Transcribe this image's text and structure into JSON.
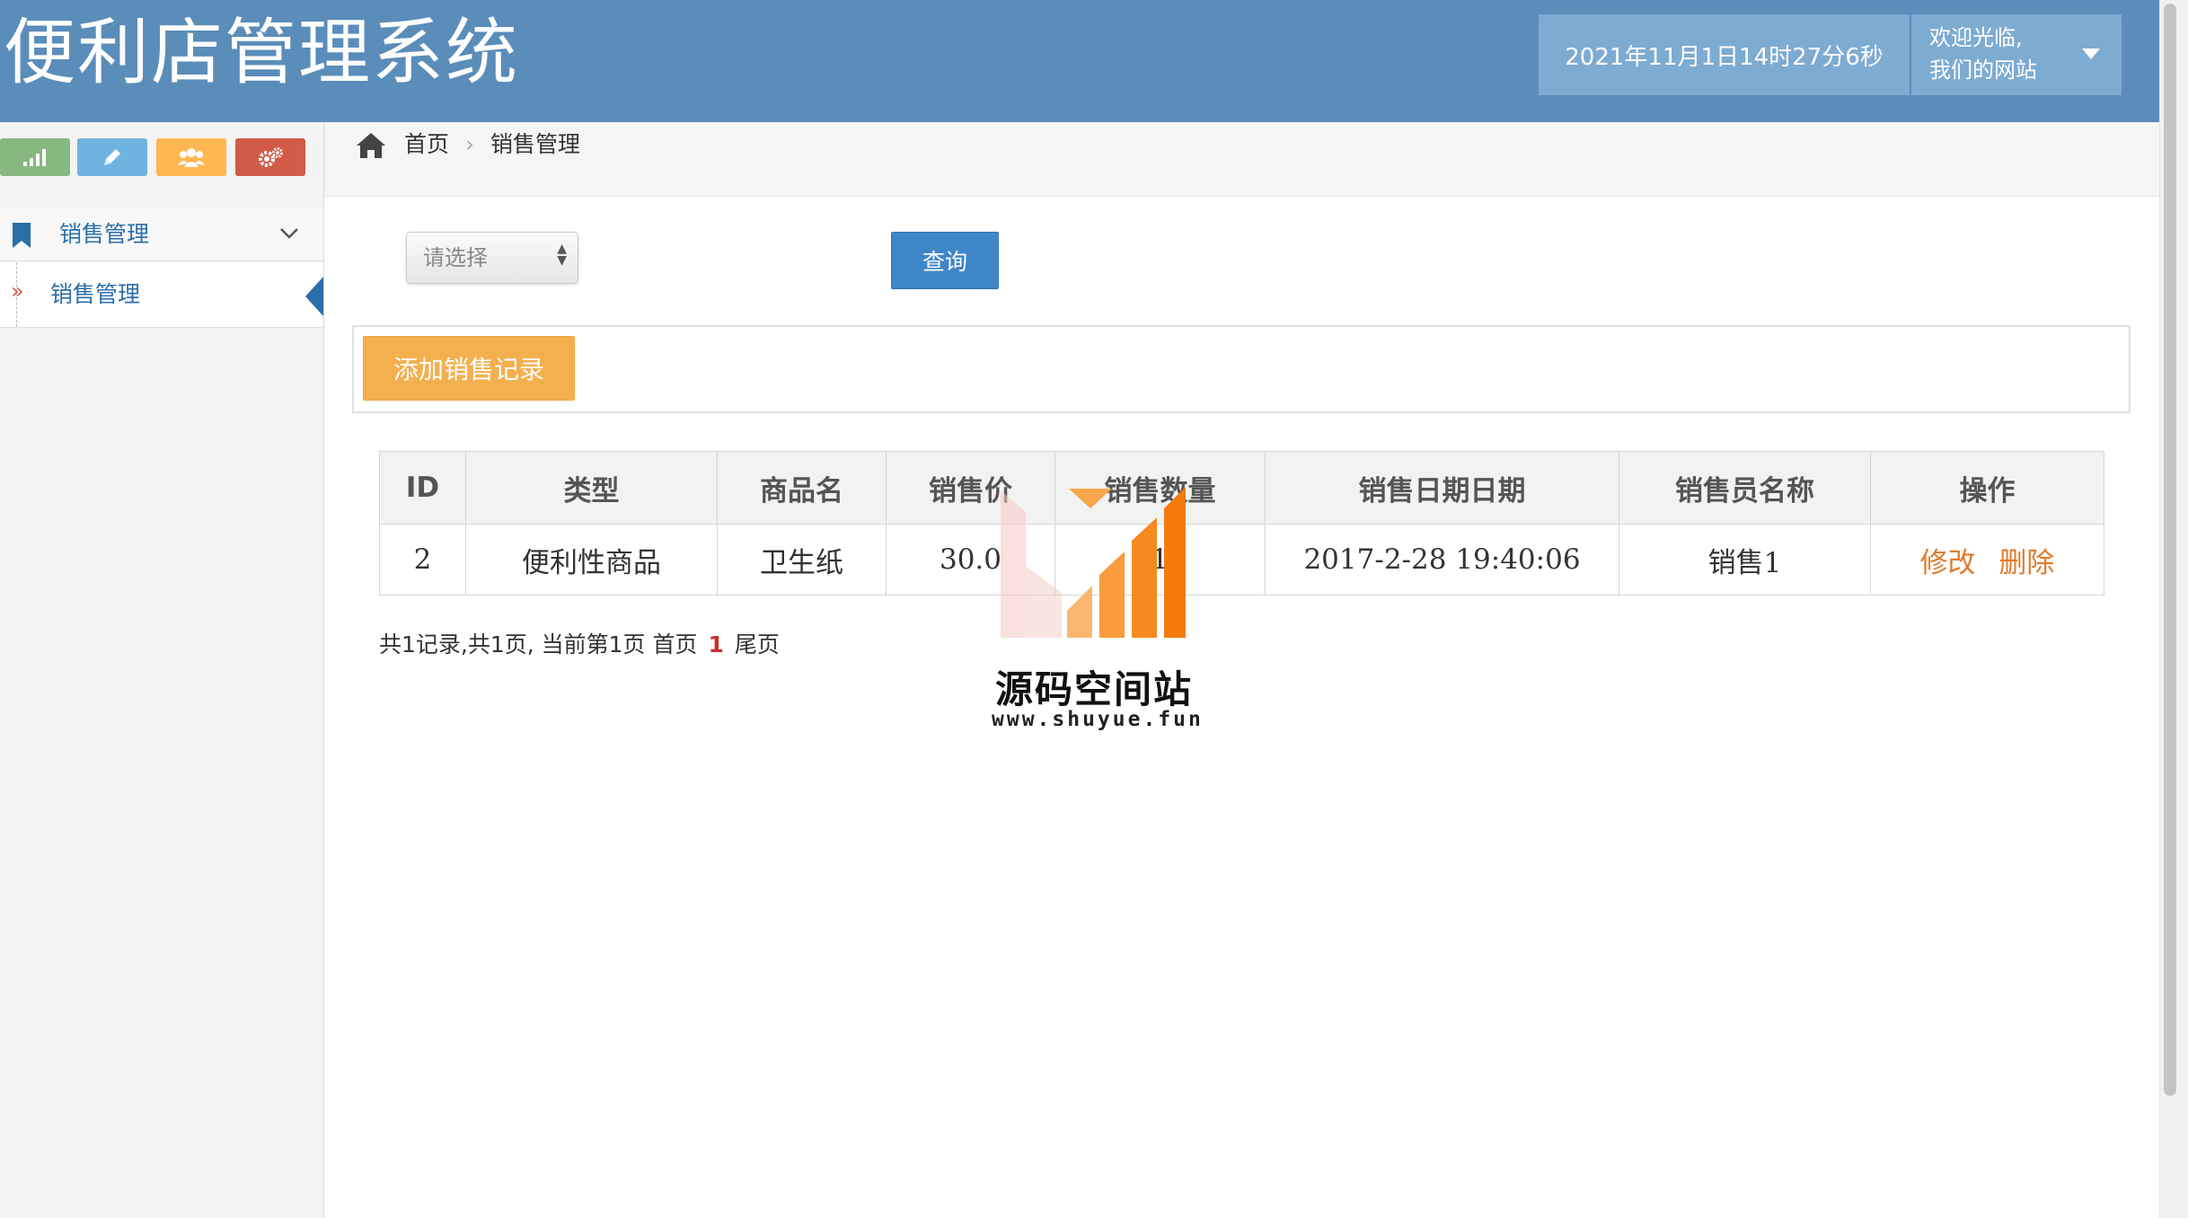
{
  "header": {
    "title": "便利店管理系统",
    "datetime": "2021年11月1日14时27分6秒",
    "welcome_line1": "欢迎光临,",
    "welcome_line2": "我们的网站"
  },
  "sidebar": {
    "shortcuts": [
      {
        "icon": "signal-icon",
        "color": "#87b87f"
      },
      {
        "icon": "pencil-icon",
        "color": "#6fb3e0"
      },
      {
        "icon": "users-icon",
        "color": "#ffb752"
      },
      {
        "icon": "cogs-icon",
        "color": "#d15b47"
      }
    ],
    "menu_label": "销售管理",
    "submenu_label": "销售管理"
  },
  "breadcrumb": {
    "home": "首页",
    "separator": "›",
    "current": "销售管理"
  },
  "filter": {
    "select_placeholder": "请选择",
    "query_label": "查询"
  },
  "toolbar": {
    "add_label": "添加销售记录"
  },
  "table": {
    "headers": [
      "ID",
      "类型",
      "商品名",
      "销售价",
      "销售数量",
      "销售日期日期",
      "销售员名称",
      "操作"
    ],
    "rows": [
      {
        "id": "2",
        "type": "便利性商品",
        "product": "卫生纸",
        "price": "30.0",
        "quantity": "1",
        "date": "2017-2-28 19:40:06",
        "seller": "销售1",
        "edit": "修改",
        "delete": "删除"
      }
    ]
  },
  "pager": {
    "summary": "共1记录,共1页, 当前第1页",
    "first": "首页",
    "current": "1",
    "last": "尾页"
  },
  "watermark": {
    "title": "源码空间站",
    "url": "www.shuyue.fun"
  },
  "colors": {
    "header_bg": "#5a8db9",
    "link_blue": "#2b6ea8",
    "add_button": "#f4b04f",
    "query_button": "#3f86c8",
    "op_link": "#e07b2c"
  }
}
